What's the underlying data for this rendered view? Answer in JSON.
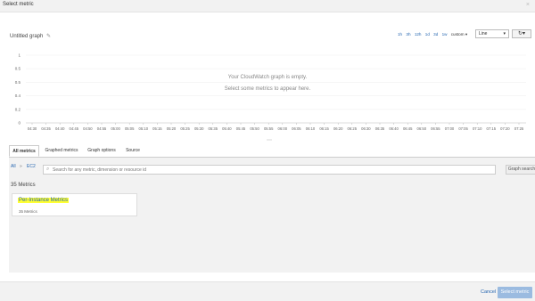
{
  "dialog": {
    "title": "Select metric",
    "close_label": "×"
  },
  "graph": {
    "title": "Untitled graph",
    "ranges": [
      "1h",
      "3h",
      "12h",
      "1d",
      "3d",
      "1w"
    ],
    "custom_label": "custom ▾",
    "type_selected": "Line",
    "empty_title": "Your CloudWatch graph is empty.",
    "empty_hint": "Select some metrics to appear here."
  },
  "chart_data": {
    "type": "line",
    "yticks": [
      "1",
      "0.5",
      "0.5",
      "0.4",
      "0.2",
      "0"
    ],
    "x": [
      "04:30",
      "04:35",
      "04:40",
      "04:45",
      "04:50",
      "04:55",
      "05:00",
      "05:05",
      "05:10",
      "05:15",
      "05:20",
      "05:25",
      "05:30",
      "05:35",
      "05:40",
      "05:45",
      "05:50",
      "05:55",
      "06:00",
      "06:05",
      "06:10",
      "06:15",
      "06:20",
      "06:25",
      "06:30",
      "06:35",
      "06:40",
      "06:45",
      "06:50",
      "06:55",
      "07:00",
      "07:05",
      "07:10",
      "07:15",
      "07:20",
      "07:25"
    ],
    "series": []
  },
  "tabs": [
    "All metrics",
    "Graphed metrics",
    "Graph options",
    "Source"
  ],
  "browser": {
    "crumb_all": "All",
    "crumb_sep": "»",
    "crumb_ec2": "EC2",
    "search_placeholder": "Search for any metric, dimension or resource id",
    "graph_search_label": "Graph search",
    "count_label": "35 Metrics",
    "card": {
      "title": "Per-Instance Metrics",
      "subtitle": "35 Metrics"
    }
  },
  "footer": {
    "cancel_label": "Cancel",
    "select_label": "Select metric"
  }
}
